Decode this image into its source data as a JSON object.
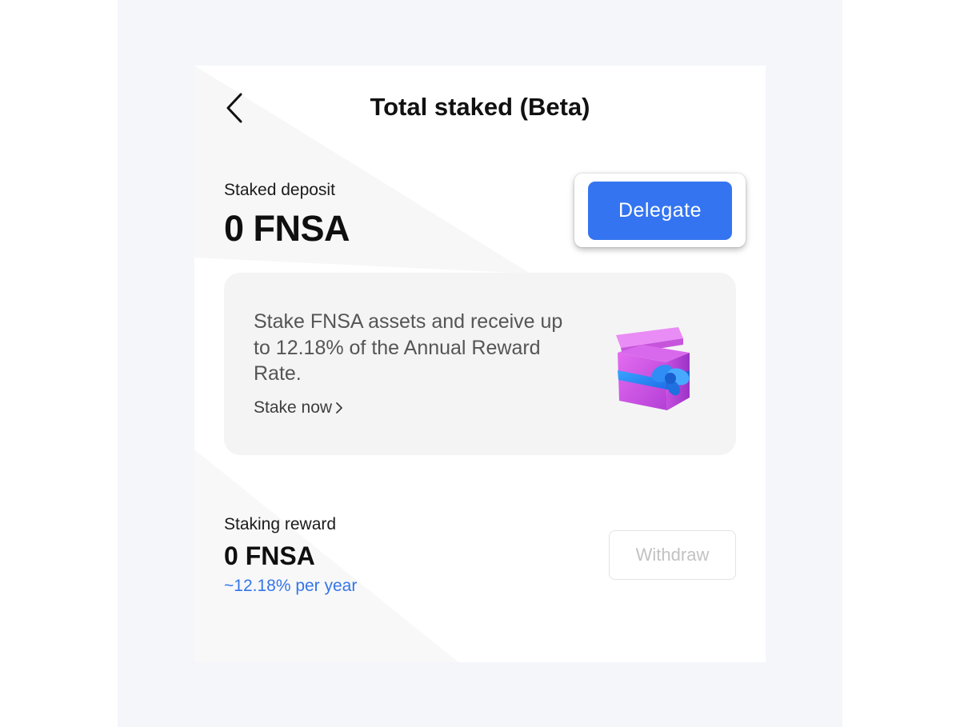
{
  "header": {
    "title": "Total staked (Beta)",
    "back_icon": "chevron-left-icon"
  },
  "deposit": {
    "label": "Staked deposit",
    "amount": "0 FNSA",
    "delegate_label": "Delegate"
  },
  "promo": {
    "text": "Stake FNSA assets and receive up to 12.18% of the Annual Reward Rate.",
    "link_label": "Stake now",
    "link_icon": "chevron-right-icon",
    "image_icon": "gift-box-icon"
  },
  "reward": {
    "label": "Staking reward",
    "amount": "0 FNSA",
    "rate": "~12.18% per year",
    "withdraw_label": "Withdraw",
    "withdraw_enabled": false
  },
  "colors": {
    "primary": "#3474f0",
    "rate_text": "#3575e8",
    "backdrop": "#f5f6fa"
  }
}
